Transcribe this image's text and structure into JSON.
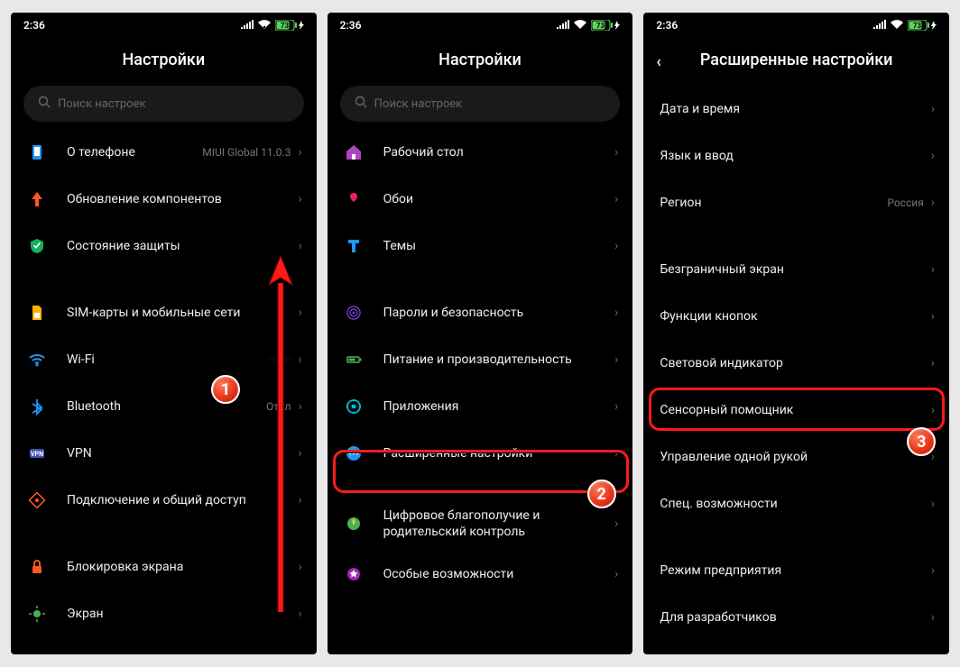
{
  "status": {
    "time": "2:36",
    "battery_pct": "73"
  },
  "screen1": {
    "title": "Настройки",
    "search_placeholder": "Поиск настроек",
    "about_phone": "О телефоне",
    "about_phone_value": "MIUI Global 11.0.3",
    "components_update": "Обновление компонентов",
    "security_status": "Состояние защиты",
    "sim_networks": "SIM-карты и мобильные сети",
    "wifi": "Wi-Fi",
    "bluetooth": "Bluetooth",
    "bluetooth_value": "Откл",
    "vpn": "VPN",
    "connection_share": "Подключение и общий доступ",
    "lock_screen": "Блокировка экрана",
    "display": "Экран"
  },
  "screen2": {
    "title": "Настройки",
    "search_placeholder": "Поиск настроек",
    "desktop": "Рабочий стол",
    "wallpaper": "Обои",
    "themes": "Темы",
    "passwords_security": "Пароли и безопасность",
    "battery_perf": "Питание и производительность",
    "apps": "Приложения",
    "advanced_settings": "Расширенные настройки",
    "digital_wellbeing": "Цифровое благополучие и родительский контроль",
    "special_features": "Особые возможности"
  },
  "screen3": {
    "title": "Расширенные настройки",
    "date_time": "Дата и время",
    "lang_input": "Язык и ввод",
    "region": "Регион",
    "region_value": "Россия",
    "fullscreen_display": "Безграничный экран",
    "button_functions": "Функции кнопок",
    "led": "Световой индикатор",
    "quick_ball": "Сенсорный помощник",
    "one_handed": "Управление одной рукой",
    "accessibility": "Спец. возможности",
    "enterprise": "Режим предприятия",
    "developer": "Для разработчиков"
  },
  "annotations": {
    "badge1": "1",
    "badge2": "2",
    "badge3": "3"
  }
}
